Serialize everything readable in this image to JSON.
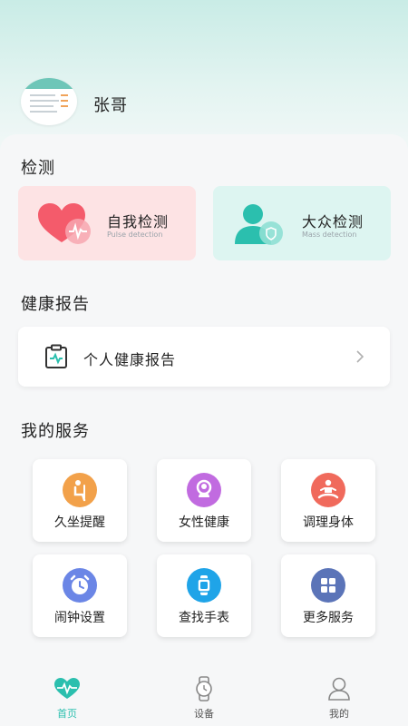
{
  "user": {
    "name": "张哥"
  },
  "sections": {
    "detect_title": "检测",
    "report_title": "健康报告",
    "services_title": "我的服务"
  },
  "detect_cards": [
    {
      "name": "自我检测",
      "sub": "Pulse detection",
      "icon": "heart-pulse-icon",
      "bg": "#fde3e4"
    },
    {
      "name": "大众检测",
      "sub": "Mass detection",
      "icon": "person-shield-icon",
      "bg": "#ddf5f1"
    }
  ],
  "report": {
    "label": "个人健康报告",
    "icon": "clipboard-pulse-icon"
  },
  "services": [
    {
      "label": "久坐提醒",
      "icon": "sitting-icon",
      "color": "#f2a14a"
    },
    {
      "label": "女性健康",
      "icon": "female-icon",
      "color": "#c16be0"
    },
    {
      "label": "调理身体",
      "icon": "meditation-icon",
      "color": "#f06a5c"
    },
    {
      "label": "闹钟设置",
      "icon": "alarm-clock-icon",
      "color": "#6b86e6"
    },
    {
      "label": "查找手表",
      "icon": "watch-icon",
      "color": "#1fa4e8"
    },
    {
      "label": "更多服务",
      "icon": "grid-icon",
      "color": "#5b74b8"
    }
  ],
  "tabs": [
    {
      "label": "首页",
      "icon": "heartbeat-icon",
      "active": true
    },
    {
      "label": "设备",
      "icon": "watch-icon",
      "active": false
    },
    {
      "label": "我的",
      "icon": "user-icon",
      "active": false
    }
  ],
  "colors": {
    "accent": "#2bbfae",
    "self_card": "#fde3e4",
    "mass_card": "#ddf5f1"
  }
}
